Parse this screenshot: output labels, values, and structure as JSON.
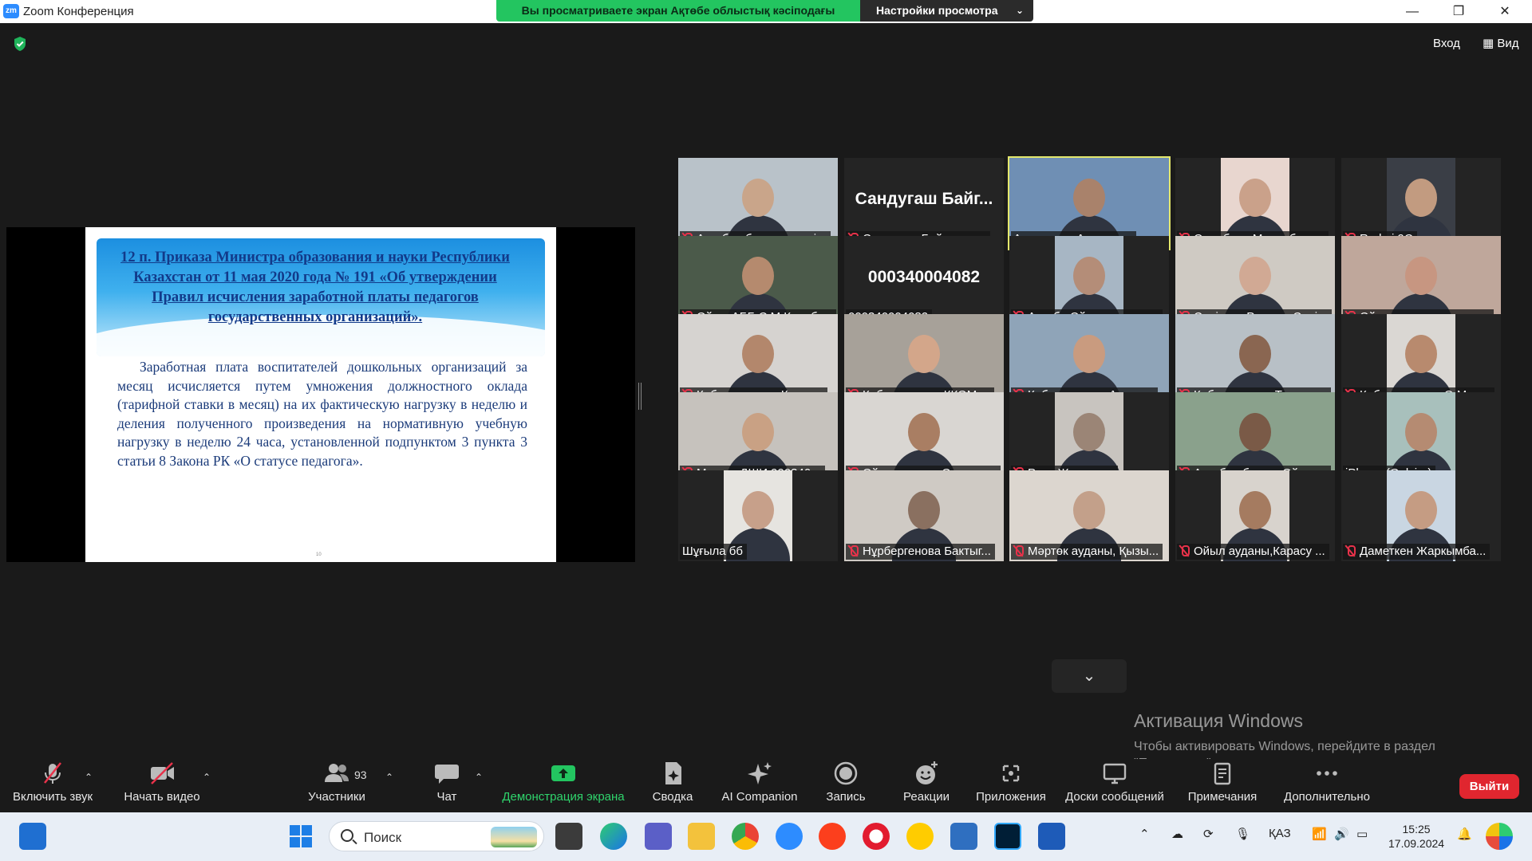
{
  "window": {
    "app_logo": "zm",
    "title": "Zoom Конференция",
    "share_banner": "Вы просматриваете экран Ақтөбе облыстық кәсіподағы",
    "view_settings": "Настройки просмотра",
    "controls": {
      "minimize": "—",
      "restore": "❐",
      "close": "✕"
    }
  },
  "top_right": {
    "login": "Вход",
    "view": "Вид"
  },
  "slide": {
    "title": "12 п. Приказа Министра образования и науки Республики Казахстан от 11 мая 2020 года № 191 «Об утверждении Правил исчисления заработной платы педагогов государственных организаций».",
    "body": "Заработная плата воспитателей дошкольных организаций за месяц исчисляется путем умножения должностного оклада (тарифной ставки в месяц) на их фактическую нагрузку в неделю и деления полученного произведения на нормативную учебную нагрузку в неделю 24 часа, установленной подпунктом 3 пункта 3 статьи 8 Закона РК «О статусе педагога».",
    "page_number": "10"
  },
  "participants": [
    {
      "label": "Ақтөбе облыстық кәсі...",
      "muted": true,
      "active": false,
      "video": true,
      "skin": "#c9a58a",
      "bg": "#b9c2c9"
    },
    {
      "label": "Сандугаш Байгуловна",
      "muted": true,
      "active": false,
      "video": false,
      "name_only": "Сандугаш  Байг..."
    },
    {
      "label": "Александр Алимпиев",
      "muted": false,
      "active": true,
      "video": true,
      "skin": "#a9826b",
      "bg": "#6f8fb4"
    },
    {
      "label": "Ордабаев Мухамбетд...",
      "muted": true,
      "active": false,
      "video": true,
      "skin": "#caa18a",
      "bg": "#e8d6cf",
      "narrow": true
    },
    {
      "label": "Redmi 9C",
      "muted": true,
      "active": false,
      "video": true,
      "skin": "#c29b80",
      "bg": "#3a3e46",
      "narrow": true
    },
    {
      "label": "Ойыл АББ С.М.Караба...",
      "muted": true,
      "active": false,
      "video": true,
      "skin": "#b58a6e",
      "bg": "#4b5a4a"
    },
    {
      "label": "000340004082",
      "muted": false,
      "active": false,
      "video": false,
      "name_only": "000340004082"
    },
    {
      "label": "Актөбе.Ойыл селосы ...",
      "muted": true,
      "active": false,
      "video": true,
      "skin": "#b48d78",
      "bg": "#a7b6c4",
      "narrow": true
    },
    {
      "label": "Серікова Раушан Сері...",
      "muted": true,
      "active": false,
      "video": true,
      "skin": "#d1a994",
      "bg": "#cfcac3"
    },
    {
      "label": "Ойыл қазақ орта мект...",
      "muted": true,
      "active": false,
      "video": true,
      "skin": "#c79681",
      "bg": "#bfa79b"
    },
    {
      "label": "Қобда ауданы, Құрса...",
      "muted": true,
      "active": false,
      "video": true,
      "skin": "#b3876c",
      "bg": "#d6d3d0"
    },
    {
      "label": "Қобда ауданы ҚКОМ ...",
      "muted": true,
      "active": false,
      "video": true,
      "skin": "#d3a68a",
      "bg": "#a7a199"
    },
    {
      "label": "Кобда ауданы Акыра...",
      "muted": true,
      "active": false,
      "video": true,
      "skin": "#c99b7f",
      "bg": "#8fa4b8"
    },
    {
      "label": "Қобда ауданы Талдыс...",
      "muted": true,
      "active": false,
      "video": true,
      "skin": "#8a6651",
      "bg": "#b8c0c6"
    },
    {
      "label": "Қобда ауданы .Ө.Мол...",
      "muted": true,
      "active": false,
      "video": true,
      "skin": "#b88a6e",
      "bg": "#dad7d3",
      "narrow": true
    },
    {
      "label": "Мартук ДШИ 990340...",
      "muted": true,
      "active": false,
      "video": true,
      "skin": "#c9a184",
      "bg": "#c6c2bd"
    },
    {
      "label": "Ойыл ауданы Сағa ме...",
      "muted": true,
      "active": false,
      "video": true,
      "skin": "#a97e63",
      "bg": "#d9d6d2"
    },
    {
      "label": "Рита Жакенова",
      "muted": true,
      "active": false,
      "video": true,
      "skin": "#9b8576",
      "bg": "#c8c4bf",
      "narrow": true
    },
    {
      "label": "Актөбе облысы Ойыл ...",
      "muted": true,
      "active": false,
      "video": true,
      "skin": "#7a5a47",
      "bg": "#8aa18c"
    },
    {
      "label": "iPhone (Gulvira)",
      "muted": false,
      "active": false,
      "video": true,
      "skin": "#b58b72",
      "bg": "#a8c0bc",
      "narrow": true
    },
    {
      "label": "Шұғыла бб",
      "muted": false,
      "active": false,
      "video": true,
      "skin": "#c7a08a",
      "bg": "#e6e4e0",
      "narrow": true
    },
    {
      "label": "Нұрбергенова Бактыг...",
      "muted": true,
      "active": false,
      "video": true,
      "skin": "#8a7060",
      "bg": "#cfcac4"
    },
    {
      "label": "Мәртөк ауданы, Қызы...",
      "muted": true,
      "active": false,
      "video": true,
      "skin": "#c3a08a",
      "bg": "#dcd6cf"
    },
    {
      "label": "Ойыл ауданы,Карасу ...",
      "muted": true,
      "active": false,
      "video": true,
      "skin": "#a57b60",
      "bg": "#d8d3cd",
      "narrow": true
    },
    {
      "label": "Даметкен Жаркымба...",
      "muted": true,
      "active": false,
      "video": true,
      "skin": "#c59c83",
      "bg": "#c9d6e2",
      "narrow": true
    }
  ],
  "windows_activation": {
    "title": "Активация Windows",
    "text": "Чтобы активировать Windows, перейдите в раздел \"Параметры\"."
  },
  "toolbar": {
    "unmute": "Включить звук",
    "start_video": "Начать видео",
    "participants": "Участники",
    "participants_count": "93",
    "chat": "Чат",
    "share_screen": "Демонстрация экрана",
    "summary": "Сводка",
    "ai_companion": "AI Companion",
    "record": "Запись",
    "reactions": "Реакции",
    "apps": "Приложения",
    "whiteboards": "Доски сообщений",
    "notes": "Примечания",
    "more": "Дополнительно",
    "leave": "Выйти"
  },
  "taskbar": {
    "search_placeholder": "Поиск",
    "language": "ҚАЗ",
    "time": "15:25",
    "date": "17.09.2024"
  },
  "colors": {
    "share_green": "#23c560",
    "active_speaker": "#e4e86c",
    "mute_red": "#e8324a",
    "leave_red": "#e0262f"
  }
}
